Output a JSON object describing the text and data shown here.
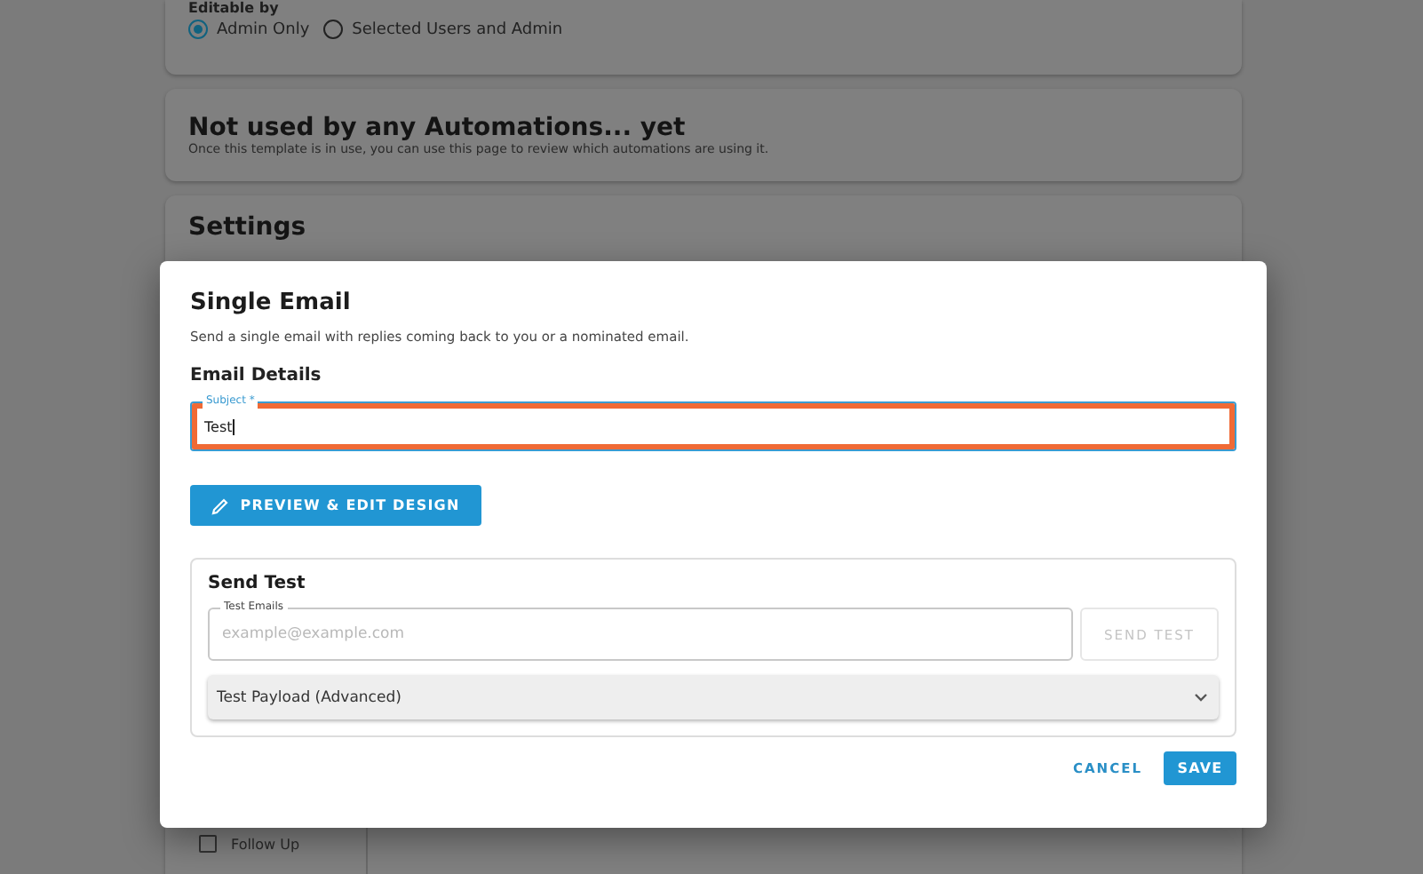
{
  "background": {
    "editable_by": {
      "label": "Editable by",
      "options": [
        {
          "label": "Admin Only",
          "selected": true
        },
        {
          "label": "Selected Users and Admin",
          "selected": false
        }
      ]
    },
    "automations": {
      "title": "Not used by any Automations... yet",
      "description": "Once this template is in use, you can use this page to review which automations are using it."
    },
    "settings": {
      "title": "Settings"
    },
    "sidebar": {
      "items": [
        {
          "label": "Follow Up",
          "checked": false
        }
      ]
    }
  },
  "dialog": {
    "title": "Single Email",
    "description": "Send a single email with replies coming back to you or a nominated email.",
    "section_title": "Email Details",
    "subject": {
      "label": "Subject *",
      "value": "Test",
      "highlighted": true
    },
    "preview_button": "PREVIEW & EDIT DESIGN",
    "send_test": {
      "title": "Send Test",
      "field": {
        "label": "Test Emails",
        "placeholder": "example@example.com"
      },
      "button": "SEND TEST",
      "payload": {
        "label": "Test Payload (Advanced)",
        "expanded": false
      }
    },
    "actions": {
      "cancel": "CANCEL",
      "save": "SAVE"
    }
  }
}
